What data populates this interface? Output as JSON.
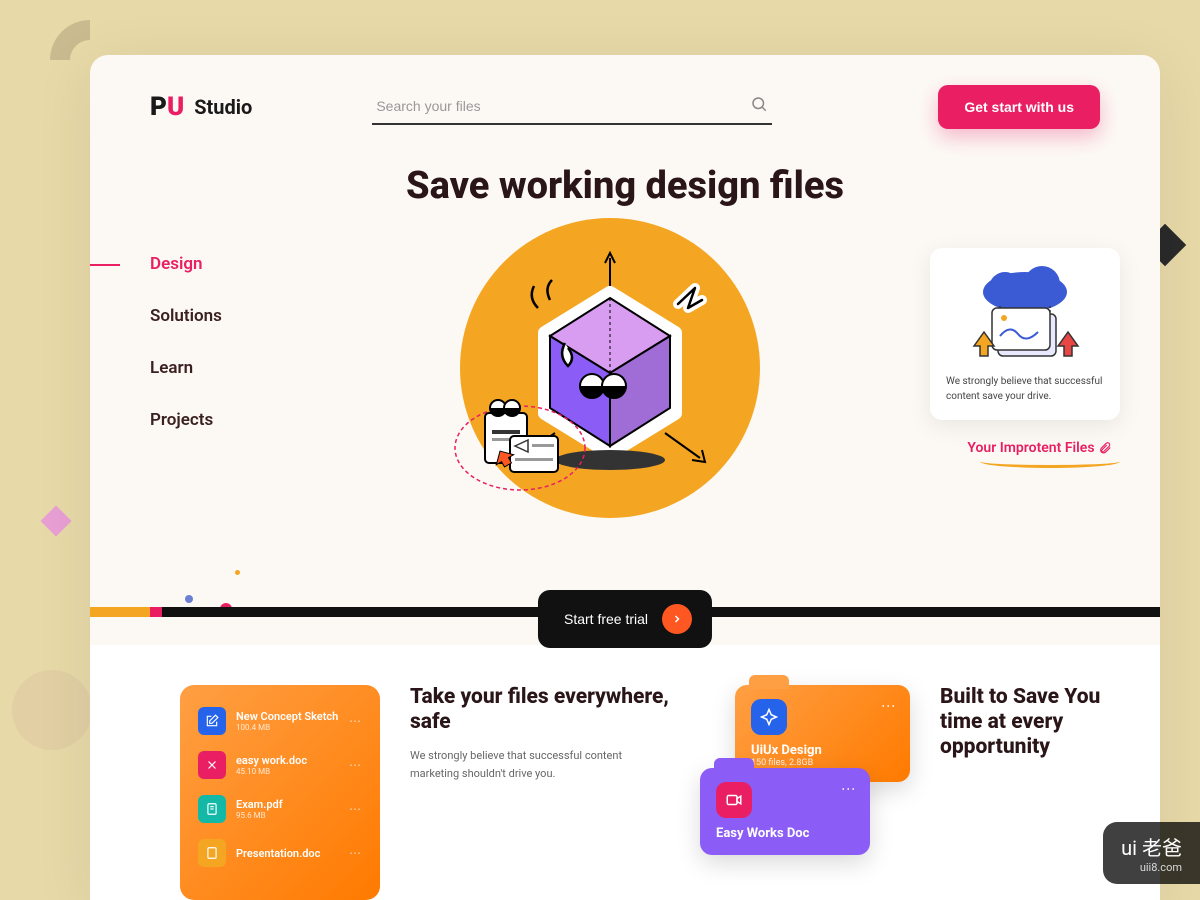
{
  "brand": {
    "name": "Studio",
    "mark_left": "P",
    "mark_right": "U"
  },
  "search": {
    "placeholder": "Search your files"
  },
  "cta": {
    "label": "Get start with us"
  },
  "hero": {
    "title": "Save working design files"
  },
  "nav": {
    "items": [
      {
        "label": "Design",
        "active": true
      },
      {
        "label": "Solutions",
        "active": false
      },
      {
        "label": "Learn",
        "active": false
      },
      {
        "label": "Projects",
        "active": false
      }
    ]
  },
  "cloud_card": {
    "text": "We strongly believe that successful content save your drive."
  },
  "important_files": {
    "label": "Your Improtent Files"
  },
  "trial": {
    "label": "Start free trial"
  },
  "section1": {
    "title": "Take your files everywhere, safe",
    "desc": "We strongly believe that successful content marketing shouldn't drive you."
  },
  "section2": {
    "title": "Built to Save You time at every opportunity"
  },
  "file_list": [
    {
      "name": "New Concept Sketch",
      "size": "100.4 MB",
      "icon_bg": "#2563eb"
    },
    {
      "name": "easy work.doc",
      "size": "45.10 MB",
      "icon_bg": "#e91e63"
    },
    {
      "name": "Exam.pdf",
      "size": "95.6 MB",
      "icon_bg": "#14b8a6"
    },
    {
      "name": "Presentation.doc",
      "size": "",
      "icon_bg": "#f4a623"
    }
  ],
  "folders": [
    {
      "title": "UiUx Design",
      "meta": "150 files, 2.8GB"
    },
    {
      "title": "Easy Works Doc",
      "meta": ""
    }
  ],
  "watermark": {
    "main": "ui 老爸",
    "sub": "uii8.com"
  },
  "colors": {
    "accent": "#e91e63",
    "warn": "#f4a623",
    "dark": "#2a1518"
  }
}
